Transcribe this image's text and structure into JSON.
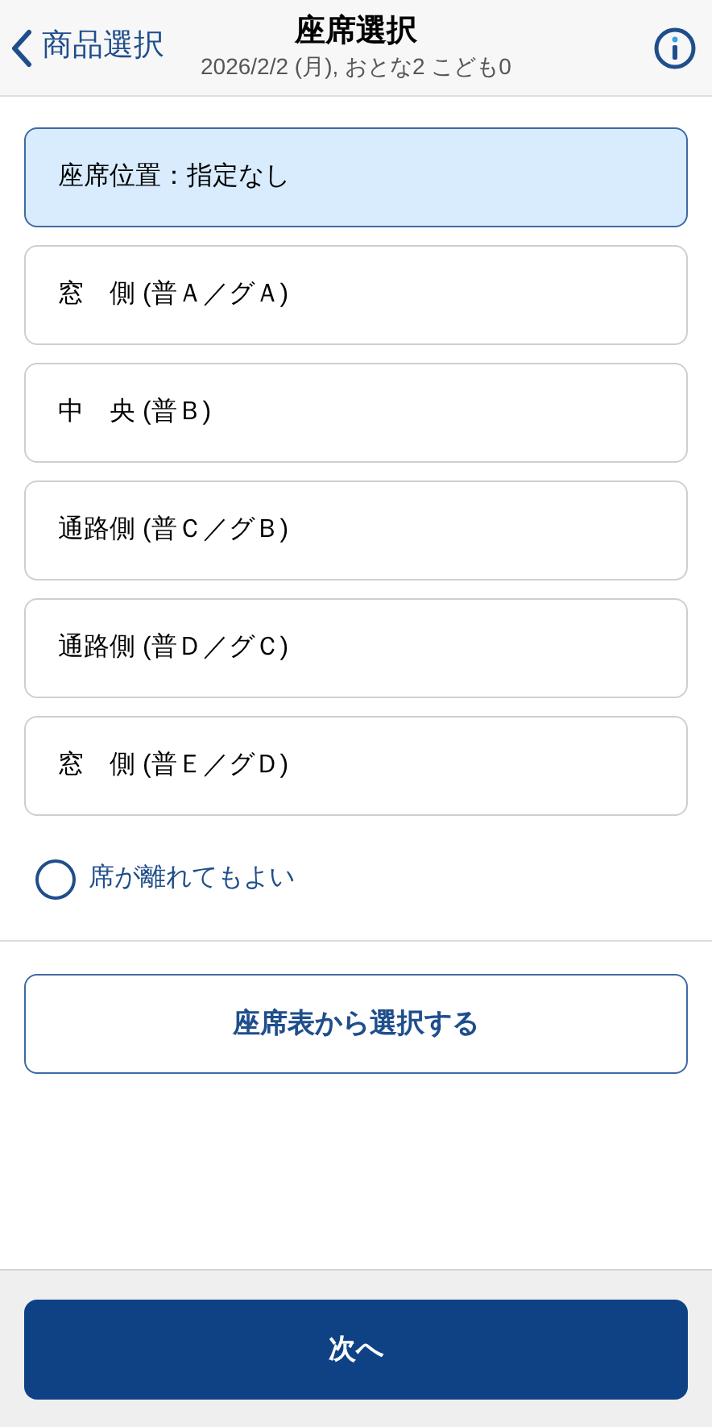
{
  "header": {
    "back_label": "商品選択",
    "title": "座席選択",
    "subtitle": "2026/2/2 (月), おとな2 こども0"
  },
  "seat_options": [
    {
      "label": "座席位置：指定なし",
      "selected": true
    },
    {
      "label": "窓　側 (普Ａ／グＡ)",
      "selected": false
    },
    {
      "label": "中　央 (普Ｂ)",
      "selected": false
    },
    {
      "label": "通路側 (普Ｃ／グＢ)",
      "selected": false
    },
    {
      "label": "通路側 (普Ｄ／グＣ)",
      "selected": false
    },
    {
      "label": "窓　側 (普Ｅ／グＤ)",
      "selected": false
    }
  ],
  "separate_ok": {
    "label": "席が離れてもよい",
    "checked": false
  },
  "seat_map_button": "座席表から選択する",
  "next_button": "次へ"
}
